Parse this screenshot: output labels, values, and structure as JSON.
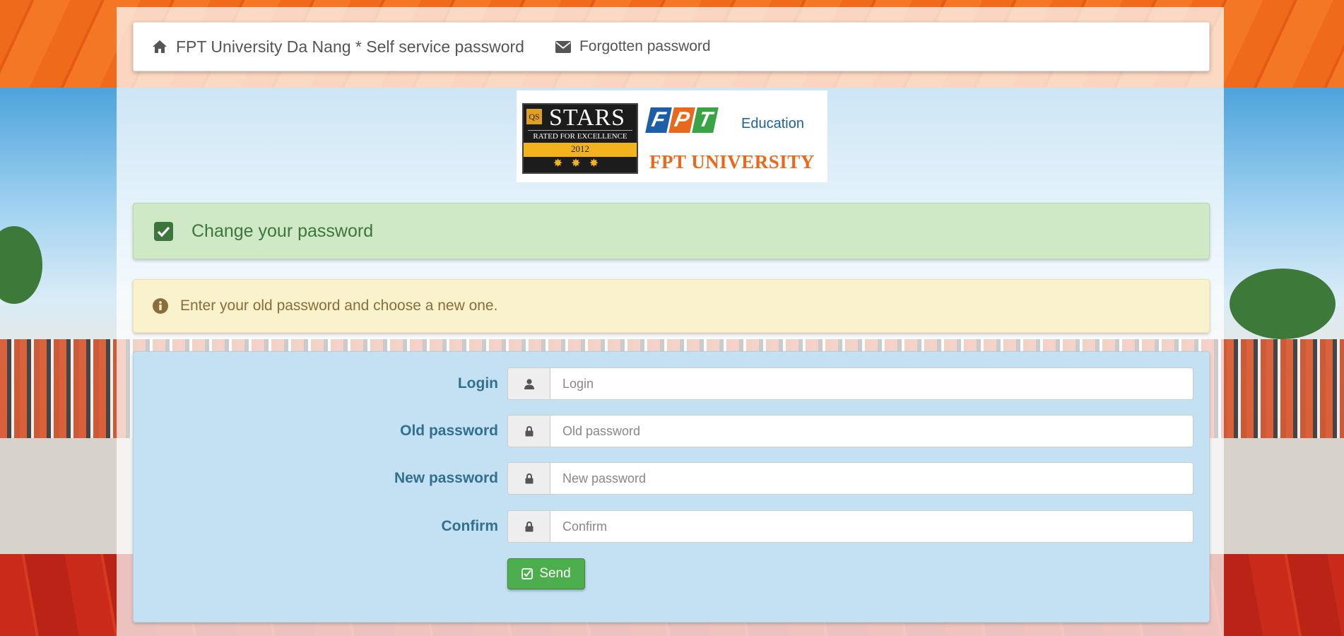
{
  "navbar": {
    "brand": "FPT University Da Nang * Self service password",
    "brand_icon": "home-icon",
    "forgotten_link": "Forgotten password",
    "forgotten_icon": "envelope-icon"
  },
  "logo": {
    "stars_qs": "QS",
    "stars_word": "STARS",
    "stars_rated": "RATED FOR EXCELLENCE",
    "stars_year": "2012",
    "fpt_letters": [
      "F",
      "P",
      "T"
    ],
    "fpt_education": "Education",
    "fpt_university": "FPT UNIVERSITY"
  },
  "alerts": {
    "title": "Change your password",
    "title_icon": "check-square-icon",
    "info": "Enter your old password and choose a new one.",
    "info_icon": "info-circle-icon"
  },
  "form": {
    "fields": [
      {
        "label": "Login",
        "placeholder": "Login",
        "value": "",
        "icon": "user-icon"
      },
      {
        "label": "Old password",
        "placeholder": "Old password",
        "value": "",
        "icon": "lock-icon"
      },
      {
        "label": "New password",
        "placeholder": "New password",
        "value": "",
        "icon": "lock-icon"
      },
      {
        "label": "Confirm",
        "placeholder": "Confirm",
        "value": "",
        "icon": "lock-icon"
      }
    ],
    "send_label": "Send",
    "send_icon": "check-square-icon"
  },
  "colors": {
    "success_text": "#3c763d",
    "warning_text": "#8a6d3b",
    "info_label": "#31708f",
    "send_button": "#4cae4c",
    "fpt_orange": "#e8691c"
  }
}
